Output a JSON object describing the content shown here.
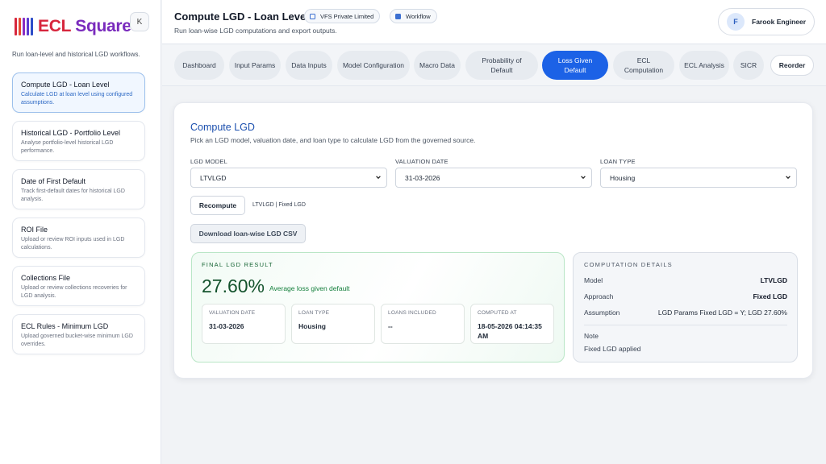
{
  "brand": {
    "logo_text_prefix": "ECL",
    "logo_text_suffix": " Square",
    "collapse_label": "K"
  },
  "sidebar": {
    "subtitle": "Run loan-level and historical LGD workflows.",
    "items": [
      {
        "title": "Compute LGD - Loan Level",
        "desc": "Calculate LGD at loan level using configured assumptions.",
        "active": true
      },
      {
        "title": "Historical LGD - Portfolio Level",
        "desc": "Analyse portfolio-level historical LGD performance."
      },
      {
        "title": "Date of First Default",
        "desc": "Track first-default dates for historical LGD analysis."
      },
      {
        "title": "ROI File",
        "desc": "Upload or review ROI inputs used in LGD calculations."
      },
      {
        "title": "Collections File",
        "desc": "Upload or review collections recoveries for LGD analysis."
      },
      {
        "title": "ECL Rules - Minimum LGD",
        "desc": "Upload governed bucket-wise minimum LGD overrides."
      }
    ]
  },
  "header": {
    "title": "Compute LGD - Loan Level",
    "chip_company": "VFS Private Limited",
    "chip_workflow": "Workflow",
    "subtitle": "Run loan-wise LGD computations and export outputs.",
    "user_initial": "F",
    "user_name": "Farook Engineer"
  },
  "tabs": [
    {
      "label": "Dashboard"
    },
    {
      "label": "Input Params"
    },
    {
      "label": "Data Inputs"
    },
    {
      "label": "Model Configuration"
    },
    {
      "label": "Macro Data"
    },
    {
      "label": "Probability of Default"
    },
    {
      "label": "Loss Given Default",
      "active": true
    },
    {
      "label": "ECL Computation"
    },
    {
      "label": "ECL Analysis"
    },
    {
      "label": "SICR"
    }
  ],
  "reorder_label": "Reorder",
  "compute": {
    "title": "Compute LGD",
    "subtitle": "Pick an LGD model, valuation date, and loan type to calculate LGD from the governed source.",
    "fields": {
      "model_label": "LGD MODEL",
      "model_value": "LTVLGD",
      "date_label": "VALUATION DATE",
      "date_value": "31-03-2026",
      "loan_label": "LOAN TYPE",
      "loan_value": "Housing"
    },
    "recompute_label": "Recompute",
    "recompute_caption": "LTVLGD | Fixed LGD",
    "download_label": "Download loan-wise LGD CSV"
  },
  "result": {
    "label": "FINAL LGD RESULT",
    "value": "27.60%",
    "desc": "Average loss given default",
    "stats": [
      {
        "key": "VALUATION DATE",
        "value": "31-03-2026"
      },
      {
        "key": "LOAN TYPE",
        "value": "Housing"
      },
      {
        "key": "LOANS INCLUDED",
        "value": "--"
      },
      {
        "key": "COMPUTED AT",
        "value": "18-05-2026 04:14:35 AM"
      }
    ]
  },
  "details": {
    "label": "COMPUTATION DETAILS",
    "rows": [
      {
        "key": "Model",
        "value": "LTVLGD"
      },
      {
        "key": "Approach",
        "value": "Fixed LGD"
      },
      {
        "key": "Assumption",
        "value": "LGD Params Fixed LGD = Y; LGD 27.60%"
      }
    ],
    "note_label": "Note",
    "note_value": "Fixed LGD applied"
  },
  "colors": {
    "accent": "#1c62e6",
    "brand_purple": "#7a2bbd",
    "brand_red": "#d7263d",
    "success": "#14532d"
  }
}
